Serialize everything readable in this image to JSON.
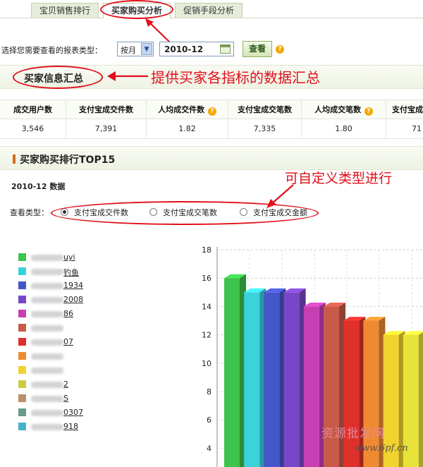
{
  "tabs": [
    {
      "label": "宝贝销售排行",
      "active": false
    },
    {
      "label": "买家购买分析",
      "active": true
    },
    {
      "label": "促销手段分析",
      "active": false
    }
  ],
  "filter": {
    "label": "选择您需要查看的报表类型：",
    "period_value": "按月",
    "date_value": "2010-12",
    "submit_label": "查看"
  },
  "summary_section": {
    "title": "买家信息汇总",
    "annotation": "提供买家各指标的数据汇总"
  },
  "summary_table": {
    "headers": [
      "成交用户数",
      "支付宝成交件数",
      "人均成交件数",
      "支付宝成交笔数",
      "人均成交笔数",
      "支付宝成"
    ],
    "values": [
      "3,546",
      "7,391",
      "1.82",
      "7,335",
      "1.80",
      "71"
    ]
  },
  "ranking_section": {
    "title": "买家购买排行TOP15",
    "data_label": "2010-12 数据",
    "annotation": "可自定义类型进行",
    "view_type_label": "查看类型：",
    "options": [
      {
        "label": "支付宝成交件数",
        "selected": true
      },
      {
        "label": "支付宝成交笔数",
        "selected": false
      },
      {
        "label": "支付宝成交金额",
        "selected": false
      }
    ]
  },
  "legend": [
    {
      "text": "uyi",
      "color": "#3cc44c"
    },
    {
      "text": "钓鱼",
      "color": "#3cd2dc"
    },
    {
      "text": "1934",
      "color": "#4456c8"
    },
    {
      "text": "2008",
      "color": "#7a46c8"
    },
    {
      "text": "86",
      "color": "#c640b4"
    },
    {
      "text": "",
      "color": "#c85a4a"
    },
    {
      "text": "07",
      "color": "#e0302c"
    },
    {
      "text": "",
      "color": "#f08a30"
    },
    {
      "text": "",
      "color": "#f2d22c"
    },
    {
      "text": "2",
      "color": "#cccc40"
    },
    {
      "text": "S",
      "color": "#b8906a"
    },
    {
      "text": "0307",
      "color": "#6a9a8e"
    },
    {
      "text": "918",
      "color": "#46b4c8"
    }
  ],
  "chart_data": {
    "type": "bar",
    "categories": [
      "uyi",
      "钓鱼",
      "1934",
      "2008",
      "86",
      "",
      "07",
      "",
      "",
      "2"
    ],
    "values": [
      16,
      15,
      15,
      15,
      14,
      14,
      13,
      13,
      12,
      12
    ],
    "colors": [
      "#3cc44c",
      "#3cd2dc",
      "#4456c8",
      "#7a46c8",
      "#c640b4",
      "#c85a4a",
      "#e0302c",
      "#f08a30",
      "#f2d22c",
      "#e8e33a"
    ],
    "title": "",
    "xlabel": "",
    "ylabel": "",
    "ylim": [
      0,
      18
    ],
    "yticks": [
      4,
      6,
      8,
      10,
      12,
      14,
      16,
      18
    ],
    "grid": true
  },
  "watermark": {
    "text": "资源批发网",
    "site": "www.6pf.cn"
  }
}
